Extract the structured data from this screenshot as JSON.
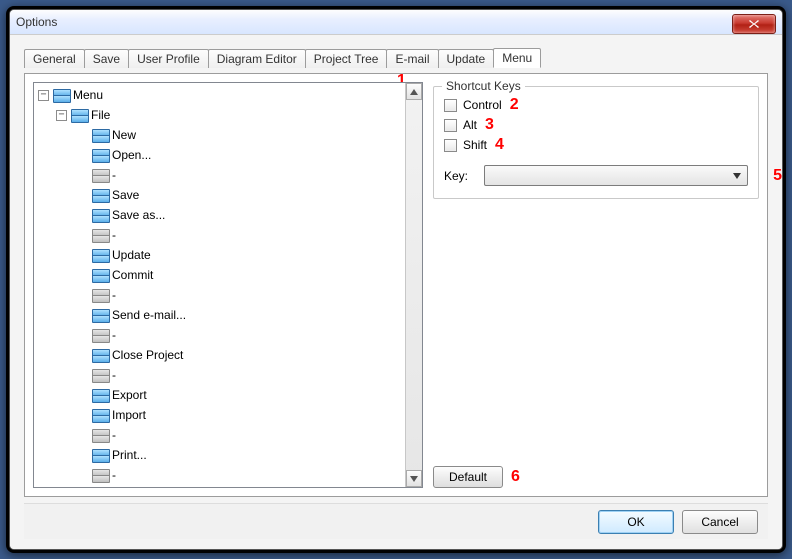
{
  "window": {
    "title": "Options"
  },
  "tabs": {
    "items": [
      "General",
      "Save",
      "User Profile",
      "Diagram Editor",
      "Project Tree",
      "E-mail",
      "Update",
      "Menu"
    ],
    "active": 7
  },
  "tree": {
    "root": {
      "label": "Menu"
    },
    "file": {
      "label": "File"
    },
    "items": [
      {
        "label": "New",
        "gray": false
      },
      {
        "label": "Open...",
        "gray": false
      },
      {
        "label": "-",
        "gray": true
      },
      {
        "label": "Save",
        "gray": false
      },
      {
        "label": "Save as...",
        "gray": false
      },
      {
        "label": "-",
        "gray": true
      },
      {
        "label": "Update",
        "gray": false
      },
      {
        "label": "Commit",
        "gray": false
      },
      {
        "label": "-",
        "gray": true
      },
      {
        "label": "Send e-mail...",
        "gray": false
      },
      {
        "label": "-",
        "gray": true
      },
      {
        "label": "Close Project",
        "gray": false
      },
      {
        "label": "-",
        "gray": true
      },
      {
        "label": "Export",
        "gray": false
      },
      {
        "label": "Import",
        "gray": false
      },
      {
        "label": "-",
        "gray": true
      },
      {
        "label": "Print...",
        "gray": false
      },
      {
        "label": "-",
        "gray": true
      }
    ]
  },
  "shortcut": {
    "group_label": "Shortcut Keys",
    "control": "Control",
    "alt": "Alt",
    "shift": "Shift",
    "key_label": "Key:",
    "key_value": ""
  },
  "buttons": {
    "default": "Default",
    "ok": "OK",
    "cancel": "Cancel"
  },
  "annotations": {
    "a1": "1",
    "a2": "2",
    "a3": "3",
    "a4": "4",
    "a5": "5",
    "a6": "6"
  }
}
